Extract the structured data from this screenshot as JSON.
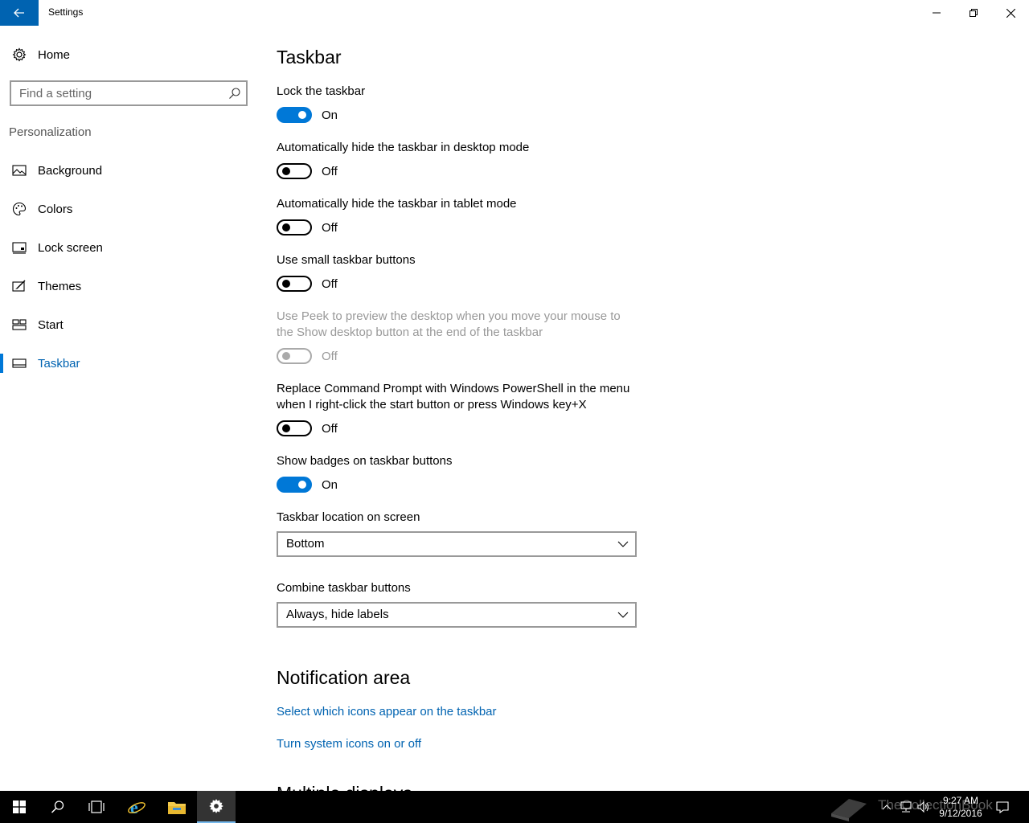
{
  "window": {
    "title": "Settings"
  },
  "sidebar": {
    "home_label": "Home",
    "search_placeholder": "Find a setting",
    "section_label": "Personalization",
    "items": [
      {
        "label": "Background",
        "icon": "picture-icon"
      },
      {
        "label": "Colors",
        "icon": "palette-icon"
      },
      {
        "label": "Lock screen",
        "icon": "lock-screen-icon"
      },
      {
        "label": "Themes",
        "icon": "themes-brush-icon"
      },
      {
        "label": "Start",
        "icon": "start-tiles-icon"
      },
      {
        "label": "Taskbar",
        "icon": "taskbar-icon",
        "active": true
      }
    ]
  },
  "main": {
    "heading": "Taskbar",
    "settings": [
      {
        "label": "Lock the taskbar",
        "state": "On"
      },
      {
        "label": "Automatically hide the taskbar in desktop mode",
        "state": "Off"
      },
      {
        "label": "Automatically hide the taskbar in tablet mode",
        "state": "Off"
      },
      {
        "label": "Use small taskbar buttons",
        "state": "Off"
      },
      {
        "label_line1": "Use Peek to preview the desktop when you move your mouse to",
        "label_line2": "the Show desktop button at the end of the taskbar",
        "state": "Off",
        "disabled": true
      },
      {
        "label_line1": "Replace Command Prompt with Windows PowerShell in the menu",
        "label_line2": "when I right-click the start button or press Windows key+X",
        "state": "Off"
      },
      {
        "label": "Show badges on taskbar buttons",
        "state": "On"
      }
    ],
    "location": {
      "label": "Taskbar location on screen",
      "value": "Bottom"
    },
    "combine": {
      "label": "Combine taskbar buttons",
      "value": "Always, hide labels"
    },
    "notification_heading": "Notification area",
    "links": [
      "Select which icons appear on the taskbar",
      "Turn system icons on or off"
    ],
    "next_heading": "Multiple displays"
  },
  "taskbar": {
    "time": "9:27 AM",
    "date": "9/12/2016",
    "watermark": "TheCollectionBook"
  },
  "colors": {
    "accent": "#0078d7",
    "accent_dark": "#0063b1",
    "taskbar_bg": "#000000"
  }
}
